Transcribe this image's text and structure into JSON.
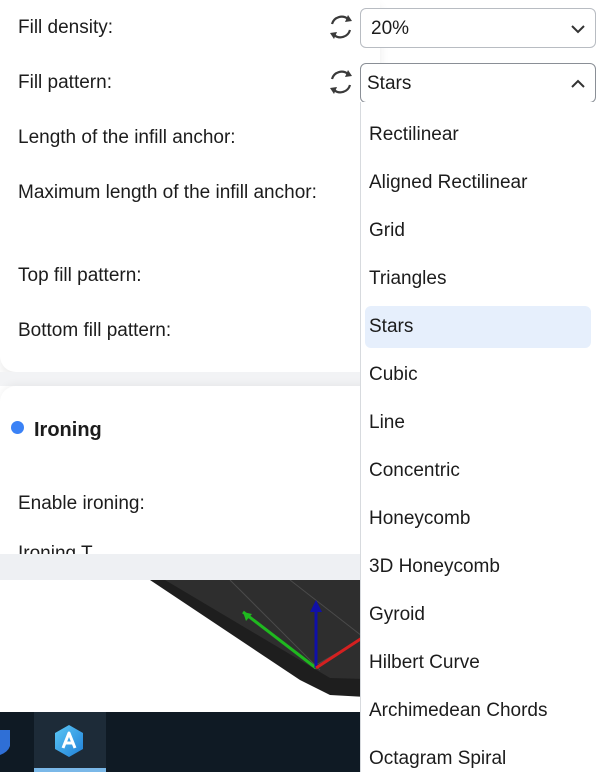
{
  "settings": {
    "fill_density": {
      "label": "Fill density:",
      "value": "20%"
    },
    "fill_pattern": {
      "label": "Fill pattern:",
      "value": "Stars"
    },
    "infill_anchor_length": {
      "label": "Length of the infill anchor:"
    },
    "infill_anchor_max": {
      "label": "Maximum length of the infill anchor:"
    },
    "top_fill_pattern": {
      "label": "Top fill pattern:"
    },
    "bottom_fill_pattern": {
      "label": "Bottom fill pattern:"
    }
  },
  "ironing": {
    "title": "Ironing",
    "enable_label": "Enable ironing:",
    "next_label_partial": "Ironing T..."
  },
  "dropdown": {
    "selected": "Stars",
    "options": [
      "Rectilinear",
      "Aligned Rectilinear",
      "Grid",
      "Triangles",
      "Stars",
      "Cubic",
      "Line",
      "Concentric",
      "Honeycomb",
      "3D Honeycomb",
      "Gyroid",
      "Hilbert Curve",
      "Archimedean Chords",
      "Octagram Spiral"
    ]
  },
  "colors": {
    "accent": "#3b82f6",
    "selected_bg": "#e6effc",
    "axis_x": "#d42020",
    "axis_y": "#1fb81f",
    "axis_z": "#1010a8",
    "taskbar": "#0f1a24"
  },
  "icons": {
    "reset": "undo-circular-arrows-icon",
    "chevron_closed": "chevron-down-icon",
    "chevron_open": "chevron-up-icon",
    "taskbar_app": "orca-slicer-app-icon",
    "taskbar_left": "shield-icon"
  }
}
